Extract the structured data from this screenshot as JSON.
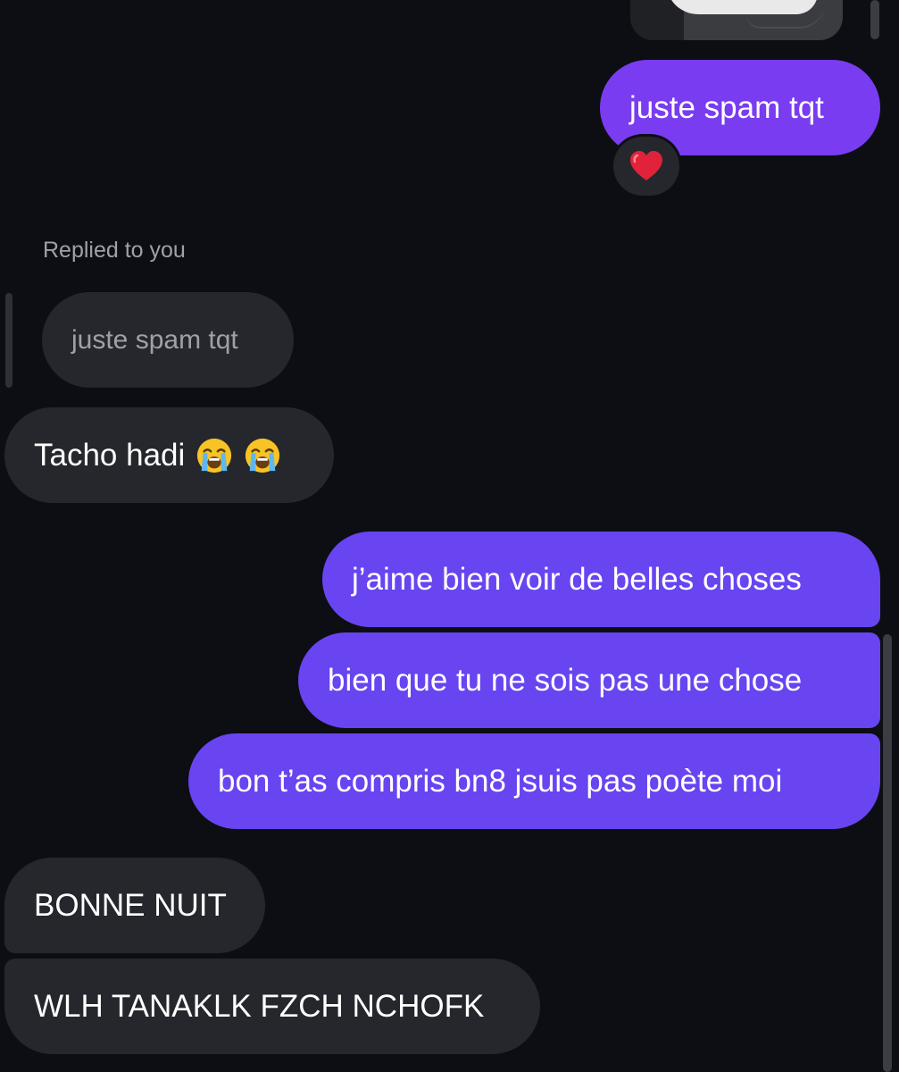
{
  "messages": {
    "m1": "juste spam tqt",
    "reaction": "heart",
    "replied_label": "Replied to you",
    "quoted": "juste spam tqt",
    "m2": "Tacho hadi",
    "m2_emoji": "loudly-crying-face",
    "m3": "j’aime bien voir de belles choses",
    "m4": "bien que tu ne sois pas une chose",
    "m5": "bon t’as compris bn8 jsuis pas poète moi",
    "m6": "BONNE NUIT",
    "m7": "WLH TANAKLK FZCH NCHOFK"
  },
  "colors": {
    "background": "#0c0e13",
    "sent_bubble": "#6845f0",
    "received_bubble": "#25272c",
    "secondary_text": "#9ea2a8"
  }
}
